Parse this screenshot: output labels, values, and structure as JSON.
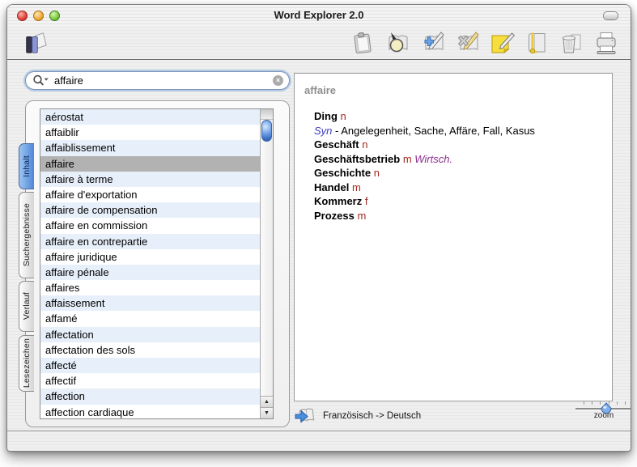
{
  "window": {
    "title": "Word Explorer 2.0"
  },
  "toolbar": {
    "icons": [
      "library-icon",
      "clipboard-icon",
      "search-book-icon",
      "add-entry-icon",
      "delete-entry-icon",
      "note-icon",
      "bookmark-icon",
      "trash-icon",
      "print-icon"
    ]
  },
  "search": {
    "value": "affaire"
  },
  "tabs": [
    {
      "label": "Inhalt",
      "selected": true
    },
    {
      "label": "Suchergebnisse",
      "selected": false
    },
    {
      "label": "Verlauf",
      "selected": false
    },
    {
      "label": "Lesezeichen",
      "selected": false
    }
  ],
  "word_list": {
    "selected_index": 3,
    "items": [
      "aérostat",
      "affaiblir",
      "affaiblissement",
      "affaire",
      "affaire à terme",
      "affaire d'exportation",
      "affaire de compensation",
      "affaire en commission",
      "affaire en contrepartie",
      "affaire juridique",
      "affaire pénale",
      "affaires",
      "affaissement",
      "affamé",
      "affectation",
      "affectation des sols",
      "affecté",
      "affectif",
      "affection",
      "affection cardiaque"
    ]
  },
  "entry": {
    "headword": "affaire",
    "lines": [
      {
        "type": "word",
        "word": "Ding",
        "gender": "n"
      },
      {
        "type": "syn",
        "label": "Syn",
        "text": "- Angelegenheit, Sache, Affäre, Fall, Kasus"
      },
      {
        "type": "word",
        "word": "Geschäft",
        "gender": "n"
      },
      {
        "type": "word",
        "word": "Geschäftsbetrieb",
        "gender": "m",
        "domain": "Wirtsch."
      },
      {
        "type": "word",
        "word": "Geschichte",
        "gender": "n"
      },
      {
        "type": "word",
        "word": "Handel",
        "gender": "m"
      },
      {
        "type": "word",
        "word": "Kommerz",
        "gender": "f"
      },
      {
        "type": "word",
        "word": "Prozess",
        "gender": "m"
      }
    ]
  },
  "status": {
    "direction": "Französisch -> Deutsch",
    "zoom_label": "zoom"
  },
  "colors": {
    "gender_red": "#a12a21",
    "syn_blue": "#3c3cc4",
    "domain_purple": "#8c2f8c",
    "selection_gray": "#b2b2b2",
    "alt_row_blue": "#e7f0fa",
    "tab_selected_blue": "#4e86d8",
    "scroller_blue": "#3366bb"
  }
}
